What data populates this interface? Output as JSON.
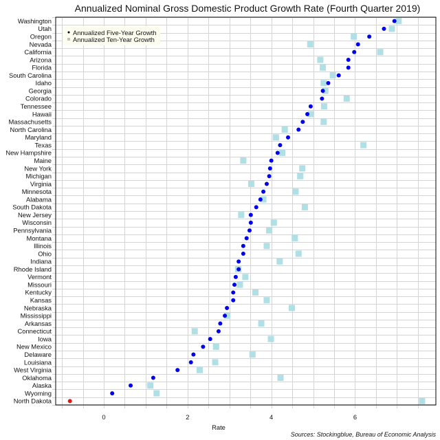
{
  "chart_data": {
    "type": "scatter",
    "title": "Annualized Nominal Gross Domestic Product Growth Rate (Fourth Quarter 2019)",
    "xlabel": "Rate",
    "ylabel": "",
    "source": "Sources: Stockingblue, Bureau of Economic Analysis",
    "xlim": [
      -1.15,
      7.93
    ],
    "x_ticks": [
      0,
      2,
      4,
      6
    ],
    "x_gridlines_step": 0.5,
    "grid": true,
    "legend_position": "top-left",
    "categories": [
      "Washington",
      "Utah",
      "Oregon",
      "Nevada",
      "California",
      "Arizona",
      "Florida",
      "South Carolina",
      "Idaho",
      "Georgia",
      "Colorado",
      "Tennessee",
      "Hawaii",
      "Massachusetts",
      "North Carolina",
      "Maryland",
      "Texas",
      "New Hampshire",
      "Maine",
      "New York",
      "Michigan",
      "Virginia",
      "Minnesota",
      "Alabama",
      "South Dakota",
      "New Jersey",
      "Wisconsin",
      "Pennsylvania",
      "Montana",
      "Illinois",
      "Ohio",
      "Indiana",
      "Rhode Island",
      "Vermont",
      "Missouri",
      "Kentucky",
      "Kansas",
      "Nebraska",
      "Mississippi",
      "Arkansas",
      "Connecticut",
      "Iowa",
      "New Mexico",
      "Delaware",
      "Louisiana",
      "West Virginia",
      "Oklahoma",
      "Alaska",
      "Wyoming",
      "North Dakota"
    ],
    "series": [
      {
        "name": "Annualized Five-Year Growth",
        "marker": "circle",
        "color": "#0000ee",
        "highlight_color": "#ee1111",
        "highlight_index": 49,
        "values": [
          6.94,
          6.69,
          6.34,
          6.07,
          5.98,
          5.84,
          5.84,
          5.61,
          5.36,
          5.23,
          5.21,
          4.94,
          4.86,
          4.75,
          4.65,
          4.4,
          4.21,
          4.15,
          4.0,
          3.97,
          3.95,
          3.89,
          3.81,
          3.74,
          3.64,
          3.51,
          3.51,
          3.48,
          3.41,
          3.33,
          3.33,
          3.22,
          3.22,
          3.15,
          3.12,
          3.09,
          3.09,
          2.94,
          2.89,
          2.78,
          2.74,
          2.54,
          2.37,
          2.14,
          2.08,
          1.76,
          1.18,
          0.64,
          0.2,
          -0.81
        ]
      },
      {
        "name": "Annualized Ten-Year Growth",
        "marker": "square",
        "color": "#b0dfe5",
        "values": [
          7.04,
          6.88,
          5.97,
          4.93,
          6.6,
          5.17,
          5.23,
          5.47,
          5.25,
          5.29,
          5.8,
          5.26,
          4.94,
          5.25,
          4.32,
          4.11,
          6.2,
          4.26,
          3.33,
          4.74,
          4.69,
          3.52,
          4.58,
          3.81,
          4.8,
          3.28,
          4.06,
          3.95,
          4.56,
          3.89,
          4.65,
          4.2,
          3.21,
          3.38,
          3.25,
          3.62,
          3.89,
          4.49,
          2.95,
          3.76,
          2.17,
          3.99,
          2.68,
          3.55,
          2.66,
          2.29,
          4.22,
          1.11,
          1.26,
          7.6
        ]
      }
    ]
  }
}
